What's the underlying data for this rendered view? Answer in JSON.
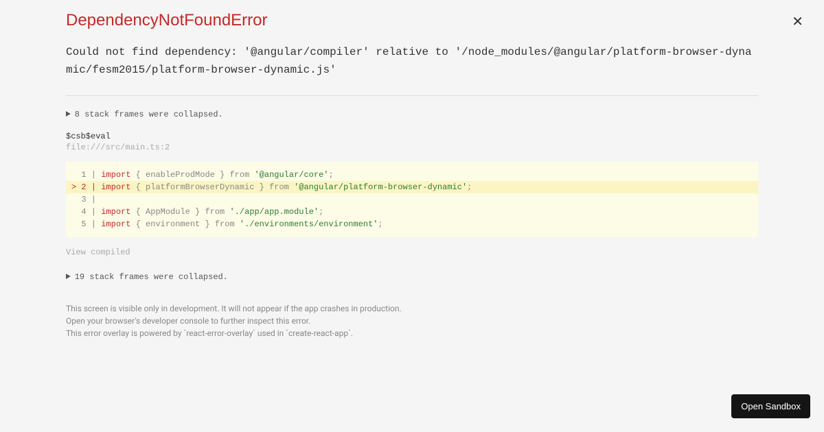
{
  "error": {
    "name": "DependencyNotFoundError",
    "message": "Could not find dependency: '@angular/compiler' relative to '/node_modules/@angular/platform-browser-dynamic/fesm2015/platform-browser-dynamic.js'"
  },
  "collapsed1": "8 stack frames were collapsed.",
  "frame": {
    "label": "$csb$eval",
    "path": "file:///src/main.ts:2"
  },
  "code": {
    "lines": [
      {
        "gutter": "  1 | ",
        "kw": "import",
        "mid": " { enableProdMode } from ",
        "str": "'@angular/core'",
        "end": ";"
      },
      {
        "gutter": "> 2 | ",
        "kw": "import",
        "mid": " { platformBrowserDynamic } from ",
        "str": "'@angular/platform-browser-dynamic'",
        "end": ";",
        "highlighted": true
      },
      {
        "gutter": "  3 | ",
        "kw": "",
        "mid": "",
        "str": "",
        "end": ""
      },
      {
        "gutter": "  4 | ",
        "kw": "import",
        "mid": " { AppModule } from ",
        "str": "'./app/app.module'",
        "end": ";"
      },
      {
        "gutter": "  5 | ",
        "kw": "import",
        "mid": " { environment } from ",
        "str": "'./environments/environment'",
        "end": ";"
      }
    ]
  },
  "view_compiled": "View compiled",
  "collapsed2": "19 stack frames were collapsed.",
  "footer": {
    "line1": "This screen is visible only in development. It will not appear if the app crashes in production.",
    "line2": "Open your browser's developer console to further inspect this error.",
    "line3": "This error overlay is powered by `react-error-overlay` used in `create-react-app`."
  },
  "open_sandbox": "Open Sandbox"
}
